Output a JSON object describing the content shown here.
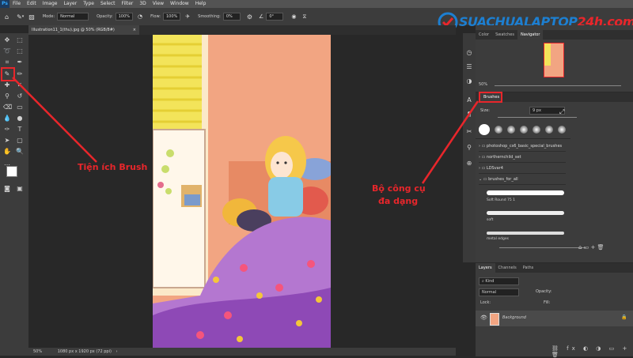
{
  "menubar": {
    "items": [
      "File",
      "Edit",
      "Image",
      "Layer",
      "Type",
      "Select",
      "Filter",
      "3D",
      "View",
      "Window",
      "Help"
    ]
  },
  "options": {
    "mode_label": "Mode:",
    "mode_value": "Normal",
    "opacity_label": "Opacity:",
    "opacity_value": "100%",
    "flow_label": "Flow:",
    "flow_value": "100%",
    "smoothing_label": "Smoothing:",
    "smoothing_value": "0%",
    "angle_value": "0°"
  },
  "document": {
    "tab_title": "Illustration11_1(thu).jpg @ 50% (RGB/8#)",
    "zoom": "50%",
    "size_info": "1080 px x 1920 px (72 ppi)"
  },
  "logo": {
    "text_a": "SUACHUALAPTOP",
    "text_b": "24h.com"
  },
  "navigator": {
    "tabs": [
      "Color",
      "Swatches",
      "Navigator"
    ],
    "active_tab": "Navigator",
    "zoom": "50%"
  },
  "brushes": {
    "tab_label": "Brushes",
    "size_label": "Size:",
    "size_value": "9 px",
    "folders": [
      "photoshop_cs6_basic_special_brushes",
      "northernchild_set",
      "LDSvar4",
      "brushes_for_all"
    ],
    "presets": [
      "Soft Round 75 1",
      "soft",
      "metal edges"
    ]
  },
  "layers": {
    "tabs": [
      "Layers",
      "Channels",
      "Paths"
    ],
    "active_tab": "Layers",
    "kind_label": "Kind",
    "blend_mode": "Normal",
    "opacity_label": "Opacity:",
    "lock_label": "Lock:",
    "fill_label": "Fill:",
    "layer_name": "Background"
  },
  "annotations": {
    "left": "Tiện ích Brush",
    "right_line1": "Bộ công cụ",
    "right_line2": "đa dạng"
  },
  "colors": {
    "accent_red": "#e8262b",
    "logo_blue": "#1d7fd1",
    "logo_red": "#e8262b",
    "panel_bg": "#3c3c3c",
    "canvas_bg": "#282828"
  }
}
